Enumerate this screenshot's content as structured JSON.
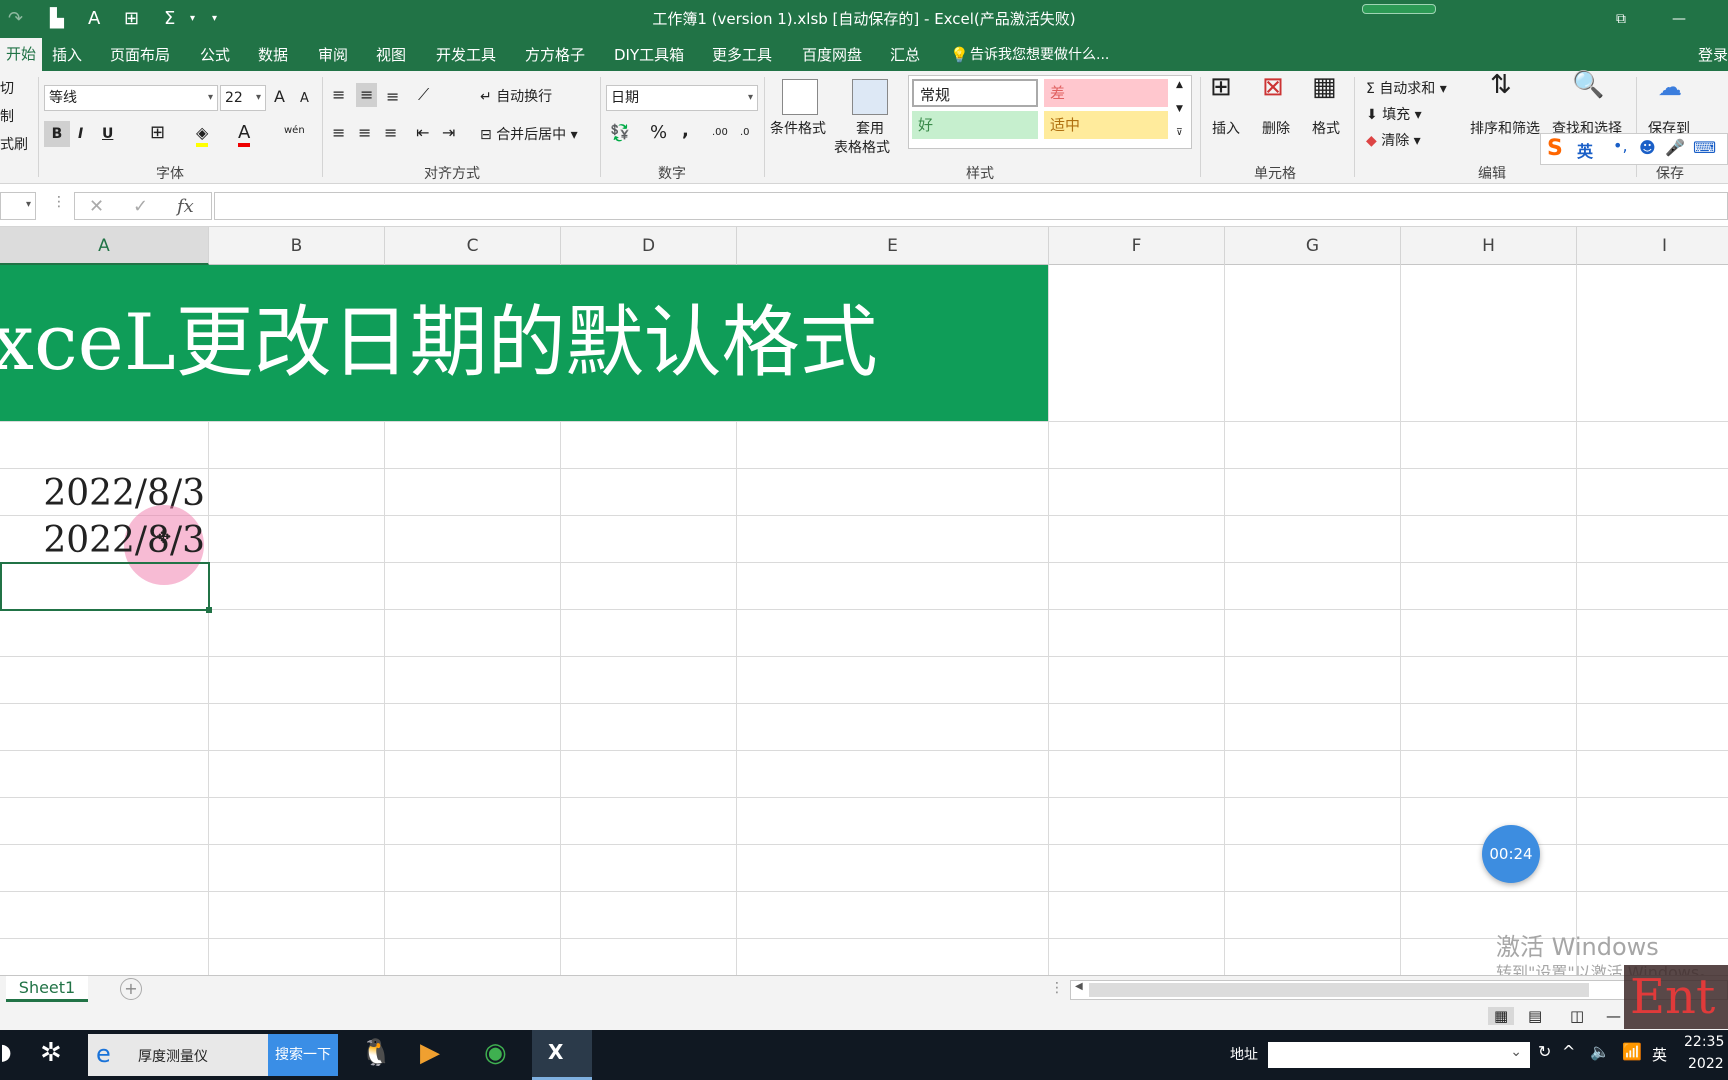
{
  "titlebar": {
    "title": "工作簿1 (version 1).xlsb [自动保存的] - Excel(产品激活失败)",
    "restore_icon": "restore-window-icon",
    "minimize_icon": "minimize-icon"
  },
  "tabs": [
    "开始",
    "插入",
    "页面布局",
    "公式",
    "数据",
    "审阅",
    "视图",
    "开发工具",
    "方方格子",
    "DIY工具箱",
    "更多工具",
    "百度网盘",
    "汇总"
  ],
  "tell_me": "告诉我您想要做什么...",
  "login": "登录",
  "ribbon": {
    "clipboard": {
      "cut": "切",
      "copy": "制",
      "painter": "式刷"
    },
    "font": {
      "name": "等线",
      "size": "22",
      "bold": "B",
      "italic": "I",
      "underline": "U",
      "grow": "A",
      "shrink": "A",
      "wen": "wén",
      "label": "字体"
    },
    "align": {
      "wrap": "自动换行",
      "merge": "合并后居中",
      "label": "对齐方式"
    },
    "number": {
      "format": "日期",
      "percent": "%",
      "comma": ",",
      "label": "数字",
      "inc": ".00",
      "dec": ".0"
    },
    "styles": {
      "cond_format": "条件格式",
      "table_format_1": "套用",
      "table_format_2": "表格格式",
      "normal": "常规",
      "bad": "差",
      "good": "好",
      "neutral": "适中",
      "label": "样式"
    },
    "cells": {
      "insert": "插入",
      "delete": "删除",
      "format": "格式",
      "label": "单元格"
    },
    "editing": {
      "autosum": "自动求和",
      "fill": "填充",
      "clear": "清除",
      "sort": "排序和筛选",
      "find": "查找和选择",
      "label": "编辑"
    },
    "save": {
      "save_to": "保存到",
      "label": "保存"
    }
  },
  "formula_bar": {
    "fx": "fx",
    "cancel": "✕",
    "enter": "✓",
    "content": ""
  },
  "columns": [
    "A",
    "B",
    "C",
    "D",
    "E",
    "F",
    "G",
    "H",
    "I"
  ],
  "sheet": {
    "banner_text": "xceL更改日期的默认格式",
    "cells": [
      "2022/8/3",
      "2022/8/3"
    ]
  },
  "sheet_tabs": [
    "Sheet1"
  ],
  "timer": "00:24",
  "watermark": {
    "line1": "激活 Windows",
    "line2": "转到\"设置\"以激活 Windows。"
  },
  "overlay_text": "Ent",
  "ime": {
    "lang": "英"
  },
  "taskbar": {
    "ie_label": "厚度测量仪",
    "search_btn": "搜索一下",
    "address_label": "地址",
    "lang": "英",
    "time": "22:35",
    "date": "2022"
  },
  "colors": {
    "excel_green": "#217346",
    "banner_green": "#0f9d58",
    "bad_bg": "#ffc7ce",
    "good_bg": "#c6efce",
    "neutral_bg": "#ffeb9c"
  }
}
